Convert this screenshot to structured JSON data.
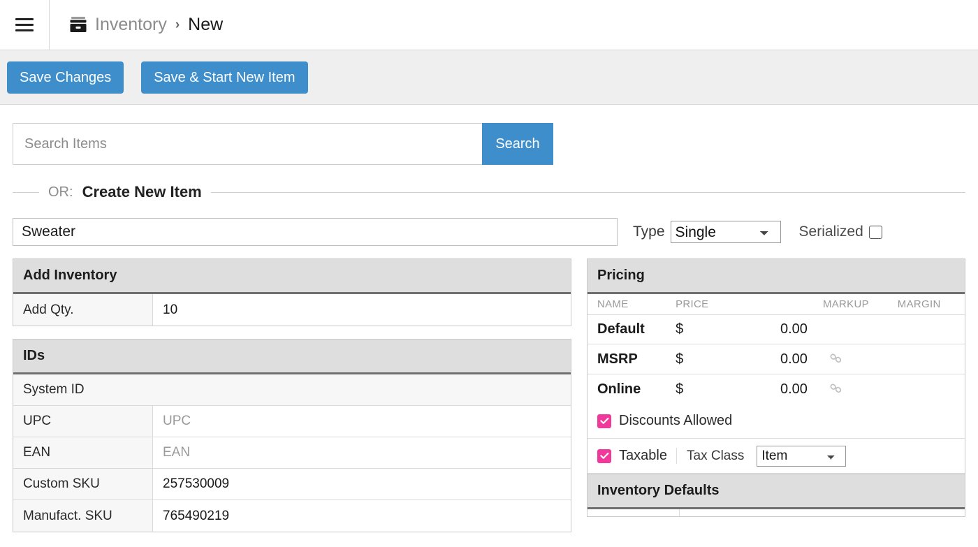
{
  "topbar": {
    "menu_icon": "hamburger-icon",
    "breadcrumb_icon": "inventory-archive-icon",
    "breadcrumb_root": "Inventory",
    "breadcrumb_separator": "›",
    "breadcrumb_current": "New"
  },
  "toolbar": {
    "save_changes_label": "Save Changes",
    "save_start_new_label": "Save & Start New Item",
    "accent_color": "#3e8ecc"
  },
  "search": {
    "placeholder": "Search Items",
    "value": "",
    "button_label": "Search"
  },
  "divider": {
    "or_label": "OR:",
    "title": "Create New Item"
  },
  "item": {
    "name_value": "Sweater",
    "type_label": "Type",
    "type_value": "Single",
    "type_options": [
      "Single"
    ],
    "serialized_label": "Serialized",
    "serialized_checked": false
  },
  "add_inventory": {
    "title": "Add Inventory",
    "rows": [
      {
        "label": "Add Qty.",
        "value": "10",
        "placeholder": false
      }
    ]
  },
  "ids": {
    "title": "IDs",
    "system_id_label": "System ID",
    "rows": [
      {
        "label": "UPC",
        "value": "UPC",
        "placeholder": true
      },
      {
        "label": "EAN",
        "value": "EAN",
        "placeholder": true
      },
      {
        "label": "Custom SKU",
        "value": "257530009",
        "placeholder": false
      },
      {
        "label": "Manufact. SKU",
        "value": "765490219",
        "placeholder": false
      }
    ]
  },
  "pricing": {
    "title": "Pricing",
    "columns": [
      "NAME",
      "PRICE",
      "MARKUP",
      "MARGIN"
    ],
    "rows": [
      {
        "name": "Default",
        "currency": "$",
        "amount": "0.00",
        "markup": "",
        "margin": "",
        "linked": false
      },
      {
        "name": "MSRP",
        "currency": "$",
        "amount": "0.00",
        "markup": "",
        "margin": "",
        "linked": true
      },
      {
        "name": "Online",
        "currency": "$",
        "amount": "0.00",
        "markup": "",
        "margin": "",
        "linked": true
      }
    ],
    "link_icon": "chain-link-icon",
    "discounts_label": "Discounts Allowed",
    "discounts_checked": true,
    "taxable_label": "Taxable",
    "taxable_checked": true,
    "tax_class_label": "Tax Class",
    "tax_class_value": "Item",
    "tax_class_options": [
      "Item"
    ],
    "checkbox_color": "#f0399a"
  },
  "inventory_defaults": {
    "title": "Inventory Defaults"
  }
}
